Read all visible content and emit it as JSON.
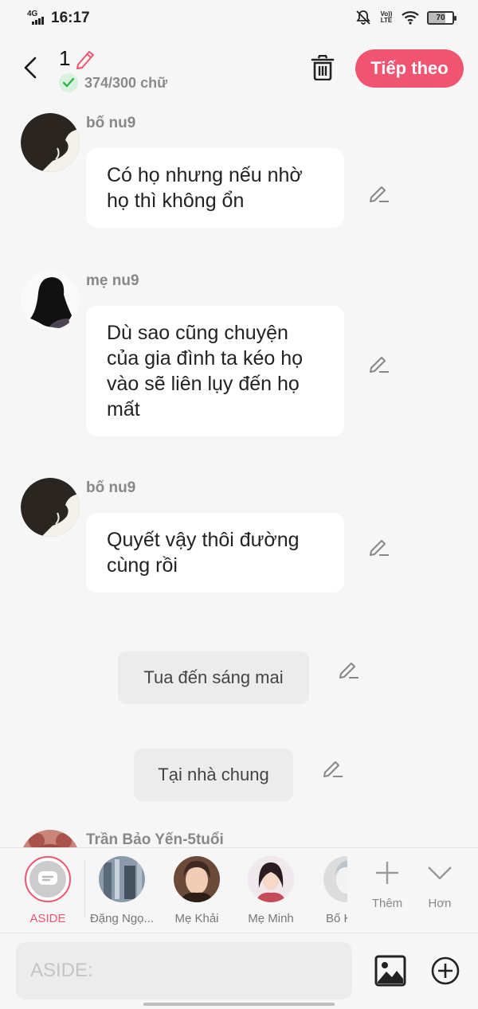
{
  "status_bar": {
    "network": "4G",
    "time": "16:17",
    "volte_top": "Vo))",
    "volte_bottom": "LTE",
    "battery": "70",
    "icons": [
      "signal-icon",
      "bell-off-icon",
      "wifi-icon",
      "battery-icon"
    ]
  },
  "header": {
    "chapter_number": "1",
    "word_count": "374/300 chữ",
    "next_label": "Tiếp theo",
    "accent_color": "#f05470"
  },
  "messages": [
    {
      "type": "character",
      "sender": "bố nu9",
      "text": "Có họ nhưng nếu nhờ họ thì không ổn"
    },
    {
      "type": "character",
      "sender": "mẹ nu9",
      "text": "Dù sao cũng chuyện của gia đình ta kéo họ vào sẽ liên lụy đến họ mất"
    },
    {
      "type": "character",
      "sender": "bố nu9",
      "text": "Quyết vậy thôi đường cùng rồi"
    },
    {
      "type": "narration",
      "text": "Tua đến sáng mai"
    },
    {
      "type": "narration",
      "text": "Tại nhà chung"
    },
    {
      "type": "character",
      "sender": "Trần Bảo Yến-5tuổi",
      "text": ""
    }
  ],
  "characters": [
    {
      "name": "ASIDE",
      "selected": true
    },
    {
      "name": "Đặng Ngọ..."
    },
    {
      "name": "Mẹ Khải"
    },
    {
      "name": "Mẹ Minh"
    },
    {
      "name": "Bố K"
    }
  ],
  "tools": {
    "more_label": "Thêm",
    "less_label": "Hơn"
  },
  "input": {
    "placeholder": "ASIDE:"
  }
}
